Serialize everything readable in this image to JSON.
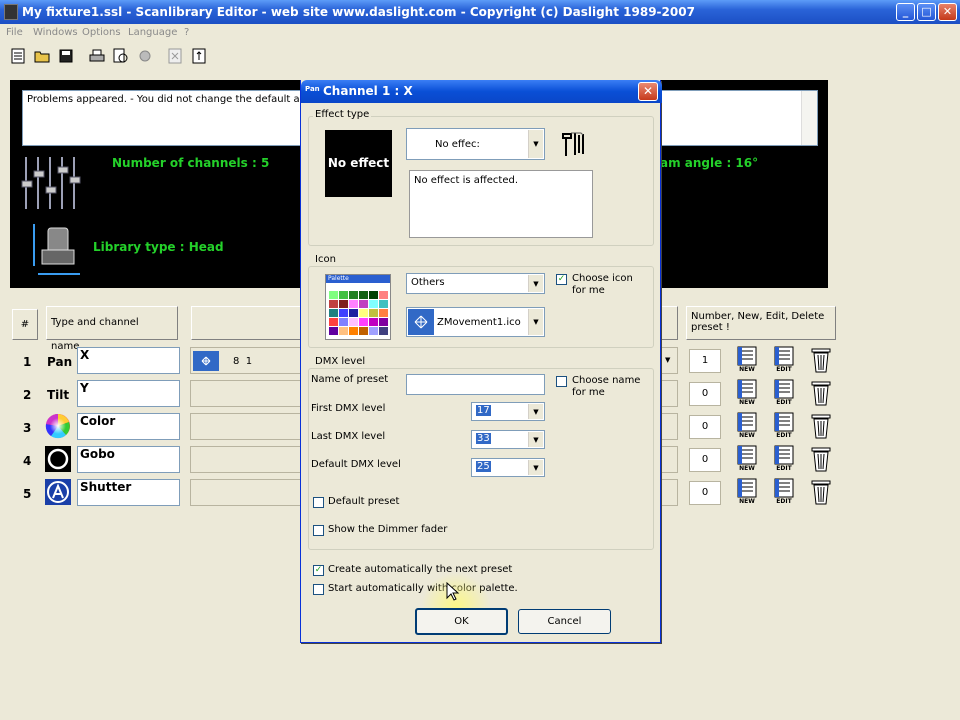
{
  "window": {
    "title": "My fixture1.ssl - Scanlibrary Editor   -  web site www.daslight.com   -  Copyright (c) Daslight 1989-2007",
    "minimize": "_",
    "maximize": "□",
    "close": "✕"
  },
  "menu": [
    "File",
    "Windows",
    "Options",
    "Language",
    "?"
  ],
  "problems_text": "Problems appeared.  -  You did not change the default angle",
  "info": {
    "channels": "Number of channels : 5",
    "library_type": "Library type : Head",
    "beam_angle": "am angle : 16°"
  },
  "table": {
    "col_hash": "#",
    "col_type_name": "Type and channel name.",
    "col_actions": "Number, New, Edit, Delete preset !",
    "new_label": "NEW",
    "edit_label": "EDIT",
    "rows": [
      {
        "num": "1",
        "type": "Pan",
        "name": "X",
        "count": "1",
        "preset": "8  1"
      },
      {
        "num": "2",
        "type": "Tilt",
        "name": "Y",
        "count": "0"
      },
      {
        "num": "3",
        "type": "",
        "name": "Color",
        "count": "0"
      },
      {
        "num": "4",
        "type": "",
        "name": "Gobo",
        "count": "0"
      },
      {
        "num": "5",
        "type": "",
        "name": "Shutter",
        "count": "0"
      }
    ]
  },
  "dialog": {
    "title": "Channel 1 : X",
    "icon_text": "Pan",
    "effect": {
      "group_label": "Effect type",
      "preview": "No effect",
      "combo": "No effec:",
      "description": "No effect is affected."
    },
    "icon": {
      "group_label": "Icon",
      "palette_caption": "Palette",
      "category_combo": "Others",
      "icon_combo": "ZMovement1.ico",
      "choose_icon_label": "Choose icon for me",
      "choose_icon_checked": true
    },
    "dmx": {
      "group_label": "DMX level",
      "name_of_preset_label": "Name of preset",
      "name_of_preset_value": "",
      "choose_name_label": "Choose name for me",
      "choose_name_checked": false,
      "first_label": "First DMX level",
      "first_value": "17",
      "last_label": "Last DMX level",
      "last_value": "33",
      "default_label": "Default DMX level",
      "default_value": "25",
      "default_preset_label": "Default preset",
      "show_dimmer_label": "Show the Dimmer fader"
    },
    "create_next_label": "Create automatically the next preset",
    "create_next_checked": true,
    "start_color_label": "Start automatically with color palette.",
    "ok": "OK",
    "cancel": "Cancel"
  },
  "colors": {
    "titlebar": "#2a63d8",
    "panel": "#000000",
    "info_text": "#24d12a",
    "dialog_bg": "#ece9d8"
  }
}
